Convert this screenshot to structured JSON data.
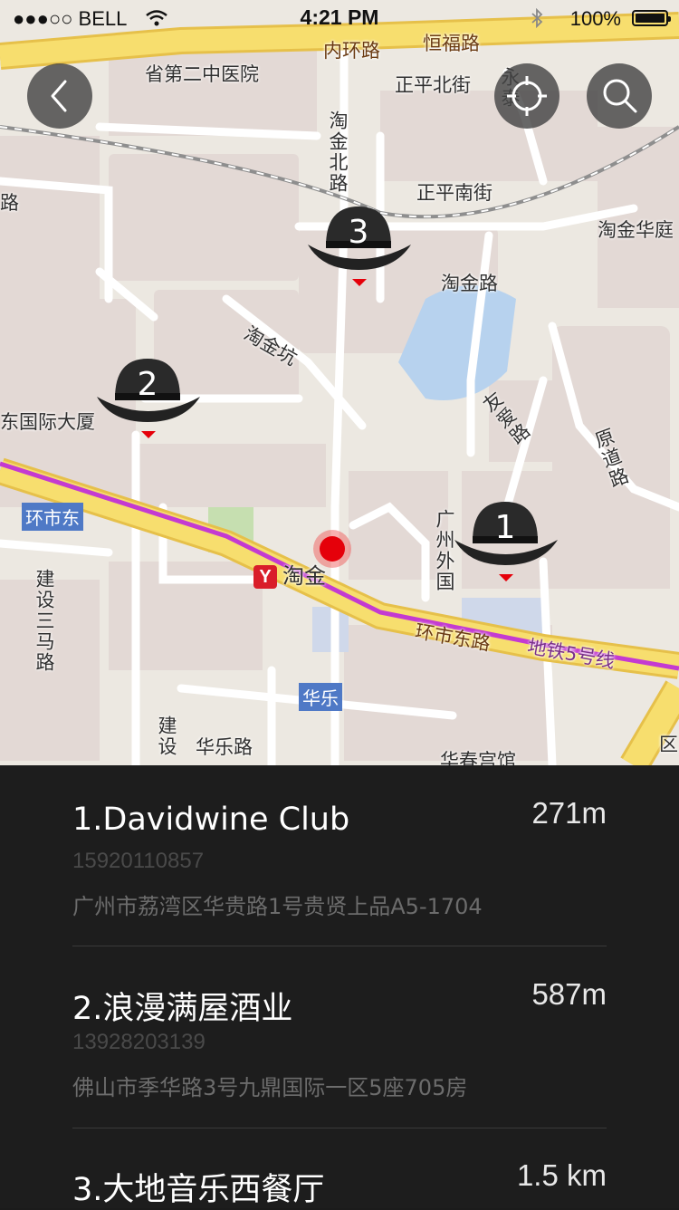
{
  "status_bar": {
    "carrier": "●●●○○ BELL",
    "time": "4:21 PM",
    "battery": "100%"
  },
  "map": {
    "labels": {
      "ring_road": "内环路",
      "hengfu_road": "恒福路",
      "hospital": "省第二中医院",
      "zhengping_north": "正平北街",
      "zhengping_south": "正平南街",
      "taojin_north": "淘金北路",
      "taojin_road": "淘金路",
      "taojin_keng": "淘金坑",
      "taojin_huating": "淘金华庭",
      "youai_road": "友爱路",
      "yuandao_road": "原道路",
      "dongfang_building": "东国际大厦",
      "huanshidong": "环市东",
      "huanshidong_road": "环市东路",
      "metro_line5": "地铁5号线",
      "taojin_station": "淘金",
      "jianshe_sanma": "建设三马路",
      "huale": "华乐",
      "huale_road": "华乐路",
      "jianshe_left": "建设",
      "guangzhou_foreign": "广州外国",
      "yong": "永泰",
      "road_left_top": "路",
      "huachun": "华春宫馆",
      "qu": "区"
    },
    "markers": [
      {
        "number": "1"
      },
      {
        "number": "2"
      },
      {
        "number": "3"
      }
    ]
  },
  "places": [
    {
      "name": "1.Davidwine Club",
      "distance": "271m",
      "phone": "15920110857",
      "address": "广州市荔湾区华贵路1号贵贤上品A5-1704"
    },
    {
      "name": "2.浪漫满屋酒业",
      "distance": "587m",
      "phone": "13928203139",
      "address": "佛山市季华路3号九鼎国际一区5座705房"
    },
    {
      "name": "3.大地音乐西餐厅",
      "distance": "1.5 km",
      "phone": "",
      "address": ""
    }
  ]
}
